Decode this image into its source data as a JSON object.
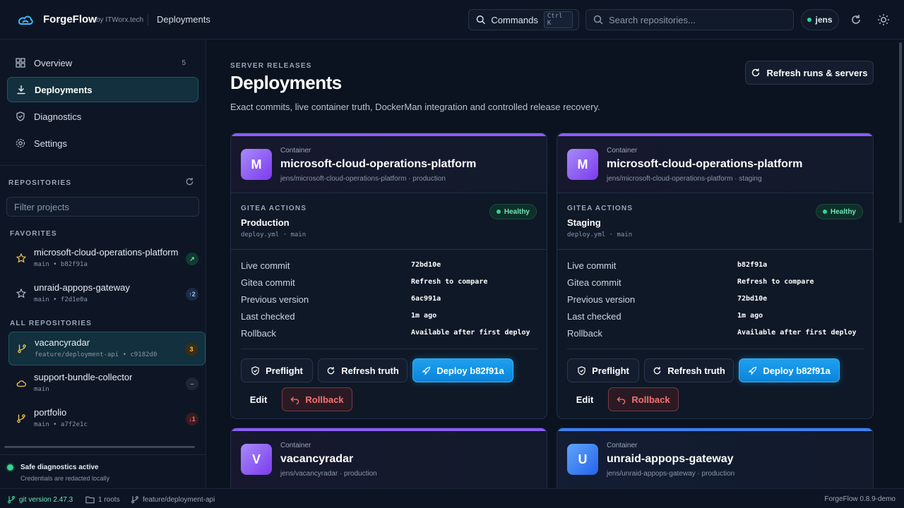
{
  "header": {
    "brand": "ForgeFlow",
    "by": "by ITWorx.tech",
    "crumb": "Deployments",
    "commands_label": "Commands",
    "commands_kbd": "Ctrl K",
    "search_placeholder": "Search repositories...",
    "user": "jens"
  },
  "sidebar": {
    "nav": [
      {
        "label": "Overview",
        "count": "5",
        "icon": "grid-icon"
      },
      {
        "label": "Deployments",
        "count": "",
        "icon": "download-icon"
      },
      {
        "label": "Diagnostics",
        "count": "",
        "icon": "shield-icon"
      },
      {
        "label": "Settings",
        "count": "",
        "icon": "gear-icon"
      }
    ],
    "repos_heading": "REPOSITORIES",
    "filter_placeholder": "Filter projects",
    "favorites_heading": "FAVORITES",
    "favorites": [
      {
        "name": "microsoft-cloud-operations-platform",
        "sub": "main • b82f91a",
        "badge": "↗"
      },
      {
        "name": "unraid-appops-gateway",
        "sub": "main • f2d1e0a",
        "badge": "↑2"
      }
    ],
    "all_heading": "ALL REPOSITORIES",
    "all": [
      {
        "name": "vacancyradar",
        "sub": "feature/deployment-api • c9182d0",
        "badge": "3"
      },
      {
        "name": "support-bundle-collector",
        "sub": "main",
        "badge": "–"
      },
      {
        "name": "portfolio",
        "sub": "main • a7f2e1c",
        "badge": "↓1"
      }
    ],
    "safe_title": "Safe diagnostics active",
    "safe_sub": "Credentials are redacted locally"
  },
  "main": {
    "eyebrow": "SERVER RELEASES",
    "title": "Deployments",
    "subtitle": "Exact commits, live container truth, DockerMan integration and controlled release recovery.",
    "refresh_all": "Refresh runs & servers",
    "cards": [
      {
        "initial": "M",
        "kind": "Container",
        "name": "microsoft-cloud-operations-platform",
        "path": "jens/microsoft-cloud-operations-platform · production",
        "gitea_label": "GITEA ACTIONS",
        "env": "Production",
        "file": "deploy.yml · main",
        "status": "Healthy",
        "rows": [
          {
            "k": "Live commit",
            "v": "72bd10e"
          },
          {
            "k": "Gitea commit",
            "v": "Refresh to compare"
          },
          {
            "k": "Previous version",
            "v": "6ac991a"
          },
          {
            "k": "Last checked",
            "v": "1m ago"
          },
          {
            "k": "Rollback",
            "v": "Available after first deploy"
          }
        ],
        "preflight": "Preflight",
        "refresh": "Refresh truth",
        "deploy": "Deploy b82f91a",
        "edit": "Edit",
        "rollback": "Rollback"
      },
      {
        "initial": "M",
        "kind": "Container",
        "name": "microsoft-cloud-operations-platform",
        "path": "jens/microsoft-cloud-operations-platform · staging",
        "gitea_label": "GITEA ACTIONS",
        "env": "Staging",
        "file": "deploy.yml · main",
        "status": "Healthy",
        "rows": [
          {
            "k": "Live commit",
            "v": "b82f91a"
          },
          {
            "k": "Gitea commit",
            "v": "Refresh to compare"
          },
          {
            "k": "Previous version",
            "v": "72bd10e"
          },
          {
            "k": "Last checked",
            "v": "1m ago"
          },
          {
            "k": "Rollback",
            "v": "Available after first deploy"
          }
        ],
        "preflight": "Preflight",
        "refresh": "Refresh truth",
        "deploy": "Deploy b82f91a",
        "edit": "Edit",
        "rollback": "Rollback"
      },
      {
        "initial": "V",
        "kind": "Container",
        "name": "vacancyradar",
        "path": "jens/vacancyradar · production"
      },
      {
        "initial": "U",
        "kind": "Container",
        "name": "unraid-appops-gateway",
        "path": "jens/unraid-appops-gateway · production"
      }
    ]
  },
  "statusbar": {
    "git": "git version 2.47.3",
    "roots": "1 roots",
    "branch": "feature/deployment-api",
    "version": "ForgeFlow 0.8.9-demo"
  },
  "colors": {
    "accent": "#0ea5e9",
    "healthy": "#34d399",
    "card_top": "#8b5cf6",
    "card_top_blue": "#3b82f6",
    "rollback": "#f87171"
  }
}
